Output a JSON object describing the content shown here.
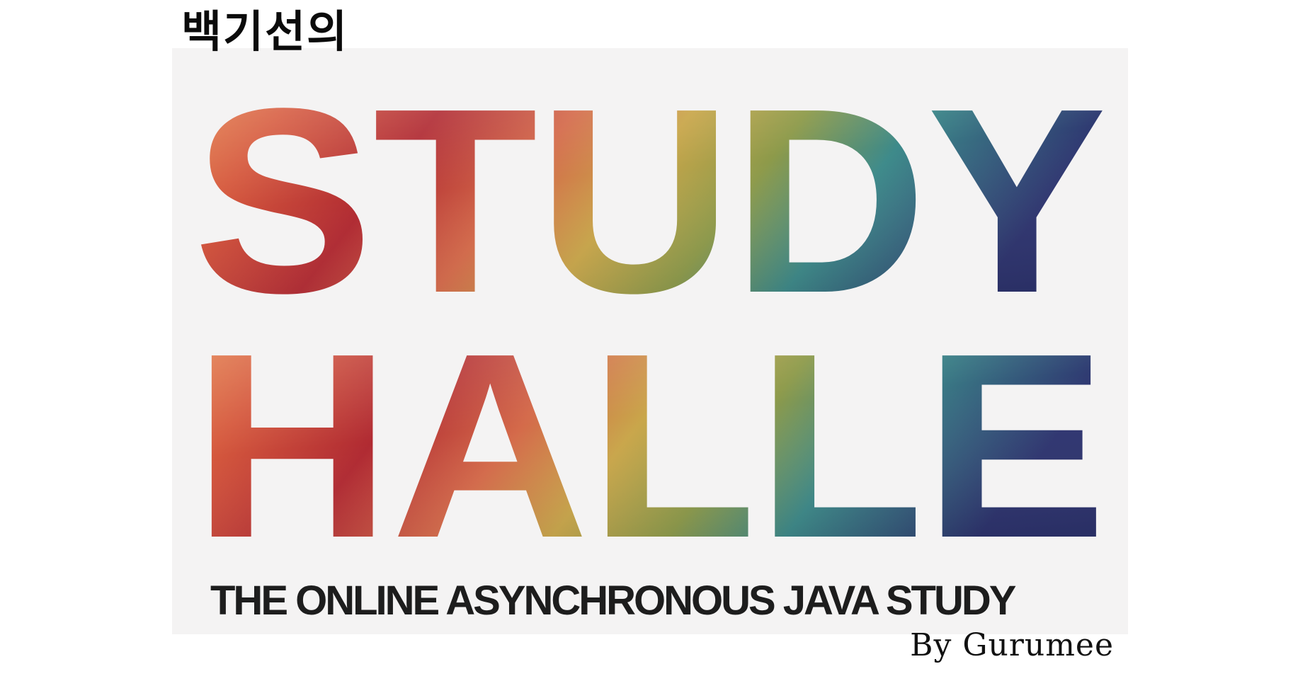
{
  "header": {
    "korean_title": "백기선의"
  },
  "logo": {
    "line1": "STUDY",
    "line2": "HALLE"
  },
  "subtitle": "THE ONLINE ASYNCHRONOUS JAVA STUDY",
  "byline": "By Gurumee",
  "colors": {
    "background": "#ffffff",
    "panel": "#f4f3f3",
    "warm_orange": "#e8884a",
    "deep_red": "#b02a32",
    "ochre": "#c9a64a",
    "teal": "#3d8a8a",
    "navy": "#2e3470",
    "text_dark": "#1d1d1d"
  }
}
